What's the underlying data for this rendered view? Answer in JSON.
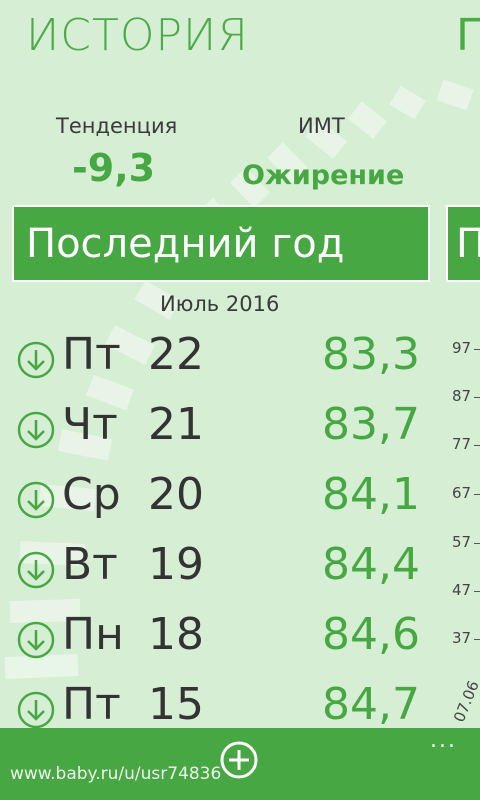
{
  "app": {
    "title": "ИСТОРИЯ",
    "next_pivot_title": "Г"
  },
  "stats": {
    "trend_label": "Тенденция",
    "trend_value": "-9,3",
    "bmi_label": "ИМТ",
    "bmi_value": "Ожирение"
  },
  "period": {
    "label": "Последний год",
    "next_label": "П"
  },
  "month_header": "Июль 2016",
  "entries": [
    {
      "day": "Пт",
      "date": "22",
      "weight": "83,3"
    },
    {
      "day": "Чт",
      "date": "21",
      "weight": "83,7"
    },
    {
      "day": "Ср",
      "date": "20",
      "weight": "84,1"
    },
    {
      "day": "Вт",
      "date": "19",
      "weight": "84,4"
    },
    {
      "day": "Пн",
      "date": "18",
      "weight": "84,6"
    },
    {
      "day": "Пт",
      "date": "15",
      "weight": "84,7"
    }
  ],
  "chart_axis": {
    "ticks": [
      "97",
      "87",
      "77",
      "67",
      "57",
      "47",
      "37"
    ],
    "date_label": "07.06"
  },
  "appbar": {
    "add_icon": "plus-circle-icon",
    "more_label": "..."
  },
  "watermark": "www.baby.ru/u/usr74836",
  "colors": {
    "accent": "#47a843",
    "background": "#d6eed4",
    "text": "#333333"
  }
}
